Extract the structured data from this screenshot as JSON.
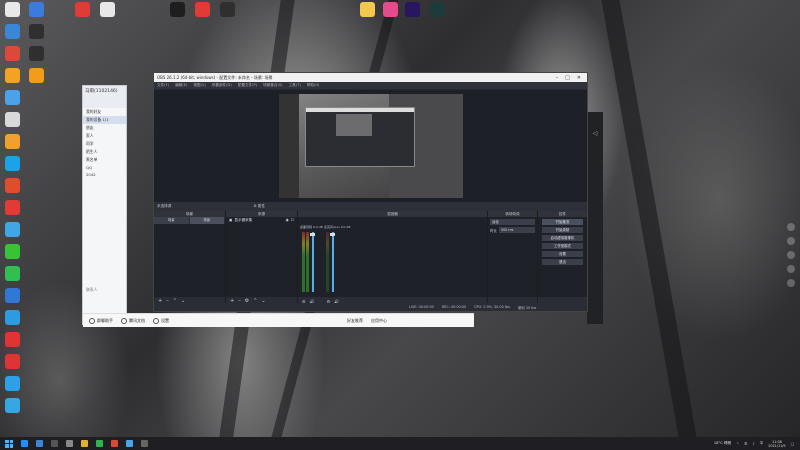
{
  "desktop": {
    "icons_left": [
      {
        "label": "",
        "color": "#e8e8e8"
      },
      {
        "label": "",
        "color": "#3a87d8"
      },
      {
        "label": "",
        "color": "#d94a3a"
      },
      {
        "label": "",
        "color": "#f2a323"
      },
      {
        "label": "",
        "color": "#4aa3e8"
      },
      {
        "label": "",
        "color": "#d9d9d9"
      },
      {
        "label": "",
        "color": "#f0a030"
      },
      {
        "label": "",
        "color": "#1aa3e8"
      },
      {
        "label": "",
        "color": "#e34b2d"
      },
      {
        "label": "",
        "color": "#e23b35"
      },
      {
        "label": "",
        "color": "#3fa7e3"
      },
      {
        "label": "",
        "color": "#36c436"
      },
      {
        "label": "",
        "color": "#2fc04f"
      },
      {
        "label": "",
        "color": "#3177d6"
      },
      {
        "label": "",
        "color": "#2e9be0"
      },
      {
        "label": "",
        "color": "#e03434"
      },
      {
        "label": "",
        "color": "#e03434"
      },
      {
        "label": "",
        "color": "#2da0e8"
      },
      {
        "label": "",
        "color": "#36a7e3"
      }
    ],
    "icons_col2": [
      {
        "label": "",
        "color": "#3b7be0"
      },
      {
        "label": "",
        "color": "#2f2f2f"
      },
      {
        "label": "",
        "color": "#2f2f2f"
      },
      {
        "label": "",
        "color": "#f39b1a"
      }
    ],
    "icons_top": [
      {
        "label": "",
        "color": "#e23b35"
      },
      {
        "label": "",
        "color": "#e8e8e8"
      },
      {
        "label": "",
        "color": "#1e1e1e"
      },
      {
        "label": "",
        "color": "#e23b35"
      },
      {
        "label": "",
        "color": "#2f2f2f"
      },
      {
        "label": "",
        "color": "#f2c94c"
      },
      {
        "label": "",
        "color": "#e54a8a"
      },
      {
        "label": "",
        "color": "#2a1660"
      },
      {
        "label": "",
        "color": "#1d3b3b"
      }
    ]
  },
  "qq": {
    "account": "马雨(1102146)",
    "items": [
      "我的好友",
      "我的设备 1/1",
      "朋友",
      "家人",
      "同学",
      "陌生人",
      "黑名单",
      "QQ",
      "2042"
    ],
    "footer": "联系人"
  },
  "appbar": {
    "items": [
      {
        "label": "群聊助手"
      },
      {
        "label": "腾讯文档"
      },
      {
        "label": "设置"
      }
    ],
    "right_items": [
      {
        "label": "好友推荐"
      },
      {
        "label": "应用中心"
      }
    ]
  },
  "obs": {
    "title": "OBS 26.1.2 (64-bit, windows) - 配置文件: 未命名 - 场景: 场景",
    "menu": [
      "文件(F)",
      "编辑(E)",
      "视图(V)",
      "停靠部件(D)",
      "配置文件(P)",
      "场景集合(S)",
      "工具(T)",
      "帮助(H)"
    ],
    "dock_label": "未选择源",
    "dock_lock": "属性",
    "panels": {
      "scenes": {
        "header": "场景",
        "tabs": [
          "场景",
          "场景"
        ]
      },
      "sources": {
        "header": "来源",
        "items": [
          "显示器采集"
        ]
      },
      "mixer": {
        "header": "混音器",
        "channels": [
          "桌面音频 0.0 dB",
          "麦克风/Aux 0.0 dB"
        ]
      },
      "transitions": {
        "header": "转场特效",
        "mode": "淡化",
        "duration_label": "时长",
        "duration": "300 ms"
      },
      "controls": {
        "header": "控件",
        "buttons": [
          "开始推流",
          "开始录制",
          "启动虚拟摄像机",
          "工作室模式",
          "设置",
          "退出"
        ]
      }
    },
    "status": {
      "live": "LIVE: 00:00:00",
      "rec": "REC: 00:00:00",
      "cpu": "CPU: 2.9%, 30.00 fps",
      "extra": "使用 30 fps"
    }
  },
  "taskbar": {
    "weather": "18°C 晴朗",
    "time": "11:08",
    "date": "2021/11/9",
    "ime": "中",
    "apps": [
      "#1e90ff",
      "#3a87d8",
      "#555",
      "#888",
      "#e0b030",
      "#2fb34f",
      "#d94a3a",
      "#4aa3e8",
      "#666"
    ]
  }
}
